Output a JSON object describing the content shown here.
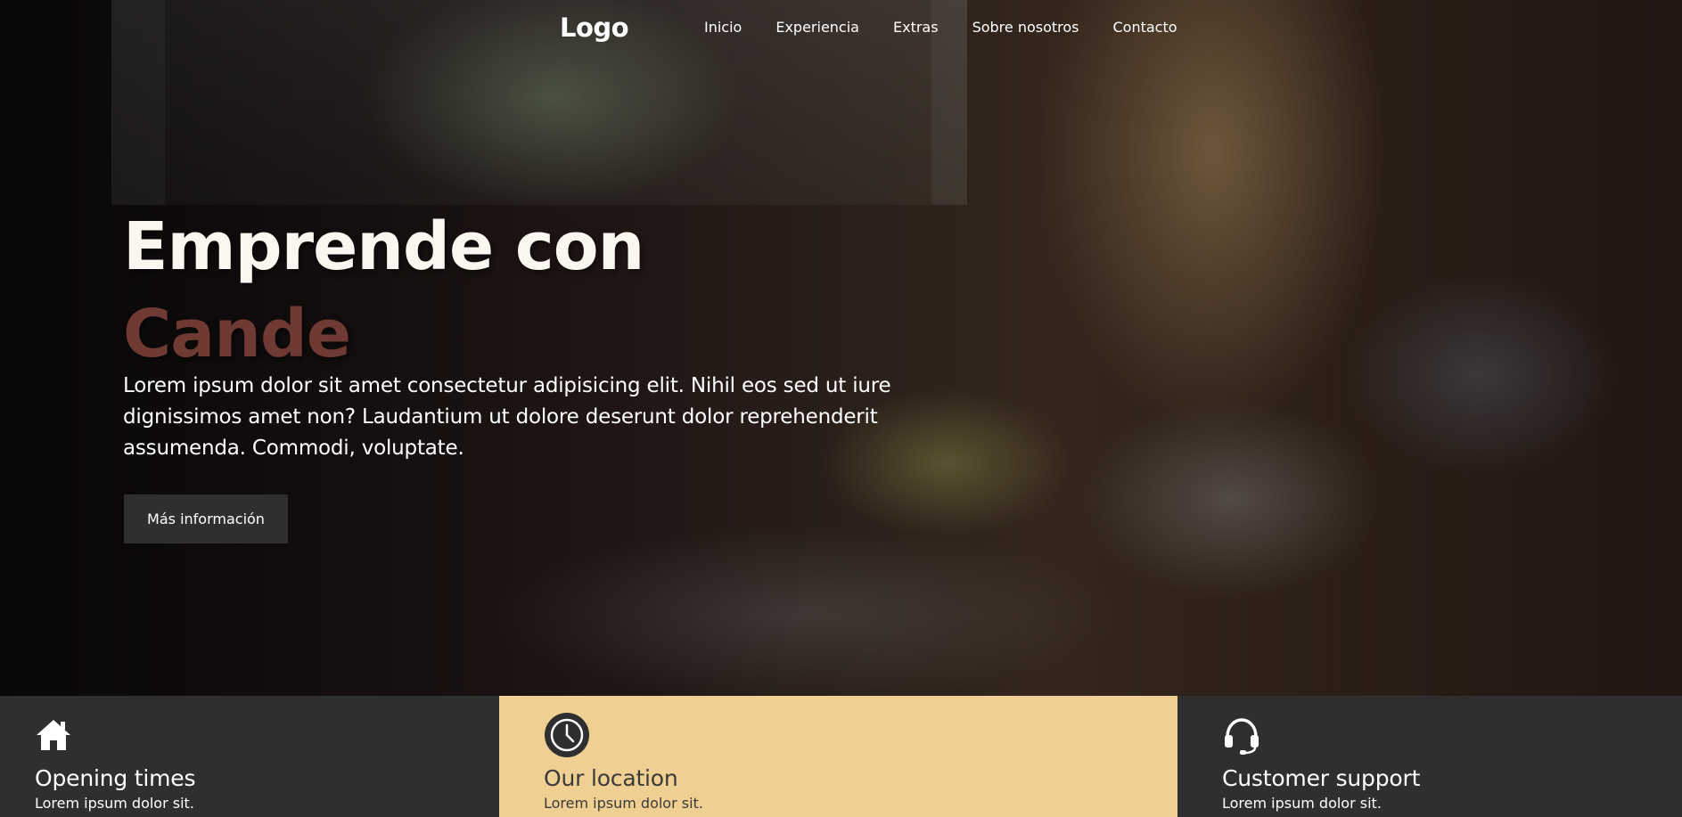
{
  "nav": {
    "logo": "Logo",
    "links": [
      "Inicio",
      "Experiencia",
      "Extras",
      "Sobre nosotros",
      "Contacto"
    ]
  },
  "hero": {
    "title_line1": "Emprende con",
    "title_line2": "Cande",
    "text": "Lorem ipsum dolor sit amet consectetur adipisicing elit. Nihil eos sed ut iure dignissimos amet non? Laudantium ut dolore deserunt dolor reprehenderit assumenda. Commodi, voluptate.",
    "button_label": "Más información"
  },
  "features": [
    {
      "icon": "home-icon",
      "title": "Opening times",
      "text": "Lorem ipsum dolor sit."
    },
    {
      "icon": "clock-icon",
      "title": "Our location",
      "text": "Lorem ipsum dolor sit."
    },
    {
      "icon": "headset-icon",
      "title": "Customer support",
      "text": "Lorem ipsum dolor sit."
    }
  ],
  "colors": {
    "accent": "#6f3a33",
    "dark": "#2f2f2f",
    "sand": "#f0d092"
  }
}
